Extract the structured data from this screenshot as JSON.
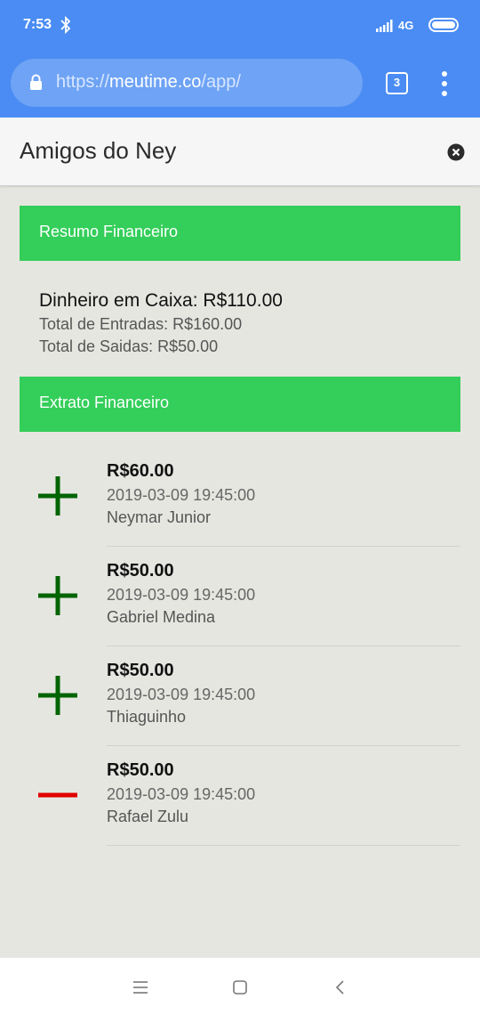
{
  "status_bar": {
    "time": "7:53",
    "network": "4G",
    "icons": [
      "bluetooth-icon",
      "signal-icon",
      "battery-icon"
    ]
  },
  "browser": {
    "url_scheme": "https://",
    "url_host": "meutime.co",
    "url_path": "/app/",
    "tab_count": "3"
  },
  "header": {
    "title": "Amigos do Ney"
  },
  "summary": {
    "section_title": "Resumo Financeiro",
    "cash": "Dinheiro em Caixa: R$110.00",
    "total_in": "Total de Entradas: R$160.00",
    "total_out": "Total de Saidas: R$50.00"
  },
  "statement": {
    "section_title": "Extrato Financeiro",
    "transactions": [
      {
        "type": "plus",
        "amount": "R$60.00",
        "date": "2019-03-09 19:45:00",
        "name": "Neymar Junior"
      },
      {
        "type": "plus",
        "amount": "R$50.00",
        "date": "2019-03-09 19:45:00",
        "name": "Gabriel Medina"
      },
      {
        "type": "plus",
        "amount": "R$50.00",
        "date": "2019-03-09 19:45:00",
        "name": "Thiaguinho"
      },
      {
        "type": "minus",
        "amount": "R$50.00",
        "date": "2019-03-09 19:45:00",
        "name": "Rafael Zulu"
      }
    ]
  },
  "colors": {
    "browser_bar": "#4a8cf3",
    "section_header": "#34ce5a",
    "plus": "#006400",
    "minus": "#e00000",
    "background": "#e6e6e1"
  }
}
